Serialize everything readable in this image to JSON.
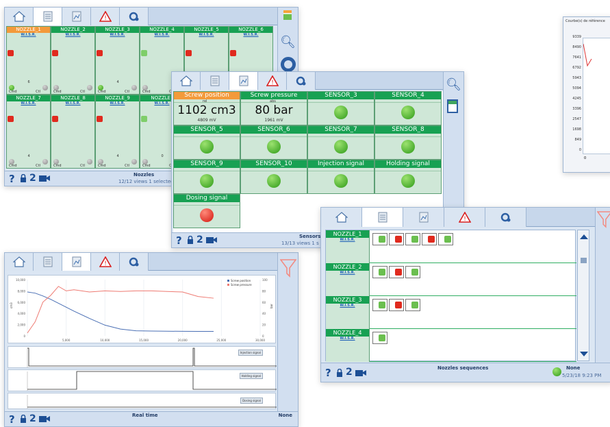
{
  "nozzles_panel": {
    "cells_row1": [
      "NOZZLE_1",
      "NOZZLE_2",
      "NOZZLE_3",
      "NOZZLE_4",
      "NOZZLE_5",
      "NOZZLE_6"
    ],
    "cells_row2": [
      "NOZZLE_7",
      "NOZZLE_8",
      "NOZZLE_9",
      "NOZZLE_"
    ],
    "wisr": "W.I.S.R.",
    "counts_row1": [
      "6",
      "",
      "4",
      "",
      "1",
      ""
    ],
    "counts_row2": [
      "4",
      "",
      "4",
      "0",
      "",
      ""
    ],
    "status_title": "Nozzles",
    "status_sub": "12/12 views 1 selected",
    "cmd": "Cmd",
    "ctl": "Ctl"
  },
  "sensors_panel": {
    "sensors": [
      {
        "label": "Screw position",
        "value": "1102 cm3",
        "sub": "4809 mV",
        "mode": "rel"
      },
      {
        "label": "Screw pressure",
        "value": "80 bar",
        "sub": "1961 mV",
        "mode": "abs"
      },
      {
        "label": "SENSOR_3"
      },
      {
        "label": "SENSOR_4"
      },
      {
        "label": "SENSOR_5"
      },
      {
        "label": "SENSOR_6"
      },
      {
        "label": "SENSOR_7"
      },
      {
        "label": "SENSOR_8"
      },
      {
        "label": "SENSOR_9"
      },
      {
        "label": "SENSOR_10"
      },
      {
        "label": "Injection signal"
      },
      {
        "label": "Holding signal"
      },
      {
        "label": "Dosing signal"
      }
    ],
    "status_title": "Sensors",
    "status_sub": "13/13 views 1 s",
    "num": "2"
  },
  "ref_curve_panel": {
    "title": "Courbe(s) de référence",
    "y_ticks": [
      "9339",
      "8490",
      "7641",
      "6792",
      "5943",
      "5094",
      "4245",
      "3396",
      "2547",
      "1698",
      "849",
      "0"
    ],
    "x_ticks": [
      "0"
    ]
  },
  "realtime_panel": {
    "status_title": "Real time",
    "status_right": "None",
    "legend_pos": "Screw position",
    "legend_pres": "Screw pressure",
    "legend_inj": "Injection signal",
    "legend_hold": "Holding signal",
    "legend_dos": "Dosing signal",
    "y_left_ticks": [
      "10,000",
      "8,000",
      "6,000",
      "4,000",
      "2,000",
      "0"
    ],
    "y_right_ticks": [
      "100",
      "80",
      "60",
      "40",
      "20",
      "0"
    ],
    "x_ticks": [
      "5,000",
      "10,000",
      "15,000",
      "20,000",
      "25,000",
      "30,000"
    ],
    "y_left_label": "cm3",
    "y_right_label": "bar",
    "num": "2"
  },
  "chart_data": {
    "type": "line",
    "x": [
      0,
      1000,
      2000,
      3000,
      4000,
      5000,
      6000,
      8000,
      10000,
      12000,
      14000,
      16000,
      18000,
      20000,
      22000,
      24000
    ],
    "series": [
      {
        "name": "Screw position",
        "values": [
          7800,
          7600,
          7100,
          6500,
          5800,
          5100,
          4400,
          3100,
          1900,
          1200,
          900,
          850,
          820,
          810,
          800,
          800
        ]
      },
      {
        "name": "Screw pressure",
        "values": [
          5,
          25,
          60,
          72,
          88,
          80,
          82,
          78,
          80,
          79,
          80,
          80,
          79,
          78,
          70,
          67
        ]
      }
    ],
    "ylim": [
      0,
      10000
    ],
    "xlim": [
      0,
      30000
    ]
  },
  "sequences_panel": {
    "nozzles": [
      "NOZZLE_1",
      "NOZZLE_2",
      "NOZZLE_3",
      "NOZZLE_4"
    ],
    "wisr": "W.I.S.R.",
    "status_title": "Nozzles sequences",
    "status_right": "None",
    "status_date": "5/23/18 9:23 PM",
    "num": "2"
  }
}
